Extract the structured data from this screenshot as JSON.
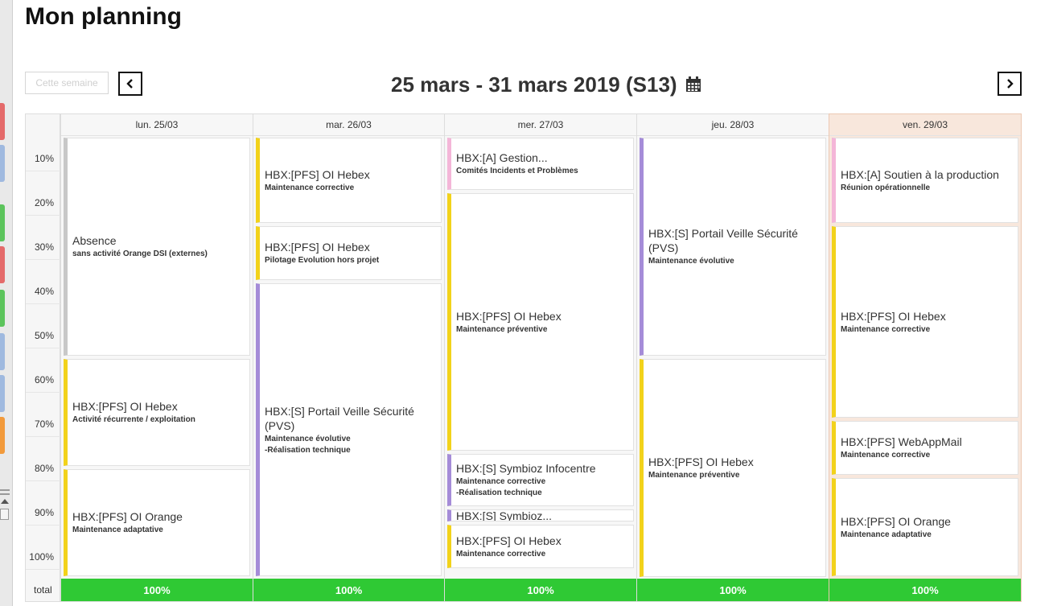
{
  "page_title": "Mon planning",
  "toolbar": {
    "this_week_label": "Cette semaine",
    "date_range": "25 mars - 31 mars 2019 (S13)"
  },
  "colors": {
    "total_bar": "#2fc934",
    "today_column": "#f8e7dc",
    "yellow": "#f2d21b",
    "purple": "#a58cd8",
    "grey": "#c8c8c8",
    "pink": "#f4b6d8"
  },
  "scale": {
    "labels": [
      "10%",
      "20%",
      "30%",
      "40%",
      "50%",
      "60%",
      "70%",
      "80%",
      "90%",
      "100%"
    ],
    "total_label": "total"
  },
  "days": [
    {
      "header": "lun. 25/03",
      "total": "100%",
      "today": false,
      "events": [
        {
          "title": "Absence",
          "subtitle": "sans activité Orange DSI (externes)",
          "color": "grey",
          "share": 0.5
        },
        {
          "title": "HBX:[PFS] OI Hebex",
          "subtitle": "Activité récurrente / exploitation",
          "color": "yellow",
          "share": 0.25
        },
        {
          "title": "HBX:[PFS] OI Orange",
          "subtitle": "Maintenance adaptative",
          "color": "yellow",
          "share": 0.25
        }
      ]
    },
    {
      "header": "mar. 26/03",
      "total": "100%",
      "today": false,
      "events": [
        {
          "title": "HBX:[PFS] OI Hebex",
          "subtitle": "Maintenance corrective",
          "color": "yellow",
          "share": 0.2
        },
        {
          "title": "HBX:[PFS] OI Hebex",
          "subtitle": "Pilotage Evolution hors projet",
          "color": "yellow",
          "share": 0.13
        },
        {
          "title": "HBX:[S] Portail Veille Sécurité (PVS)",
          "subtitle": "Maintenance évolutive",
          "subtitle2": "-Réalisation technique",
          "color": "purple",
          "share": 0.67
        }
      ]
    },
    {
      "header": "mer. 27/03",
      "total": "100%",
      "today": false,
      "events": [
        {
          "title": "HBX:[A] Gestion...",
          "subtitle": "Comités Incidents et Problèmes",
          "color": "pink",
          "share": 0.125
        },
        {
          "title": "HBX:[PFS] OI Hebex",
          "subtitle": "Maintenance préventive",
          "color": "yellow",
          "share": 0.59
        },
        {
          "title": "HBX:[S] Symbioz Infocentre",
          "subtitle": "Maintenance corrective",
          "subtitle2": "-Réalisation technique",
          "color": "purple",
          "share": 0.125
        },
        {
          "title": "HBX:[S] Symbioz...",
          "subtitle": "",
          "color": "purple",
          "share": 0.035
        },
        {
          "title": "HBX:[PFS] OI Hebex",
          "subtitle": "Maintenance corrective",
          "color": "yellow",
          "share": 0.105
        }
      ]
    },
    {
      "header": "jeu. 28/03",
      "total": "100%",
      "today": false,
      "events": [
        {
          "title": "HBX:[S] Portail Veille Sécurité (PVS)",
          "subtitle": "Maintenance évolutive",
          "color": "purple",
          "share": 0.5
        },
        {
          "title": "HBX:[PFS] OI Hebex",
          "subtitle": "Maintenance préventive",
          "color": "yellow",
          "share": 0.5
        }
      ]
    },
    {
      "header": "ven. 29/03",
      "total": "100%",
      "today": true,
      "events": [
        {
          "title": "HBX:[A] Soutien à la production",
          "subtitle": "Réunion opérationnelle",
          "color": "pink",
          "share": 0.2
        },
        {
          "title": "HBX:[PFS] OI Hebex",
          "subtitle": "Maintenance corrective",
          "color": "yellow",
          "share": 0.44
        },
        {
          "title": "HBX:[PFS] WebAppMail",
          "subtitle": "Maintenance corrective",
          "color": "yellow",
          "share": 0.13
        },
        {
          "title": "HBX:[PFS] OI Orange",
          "subtitle": "Maintenance adaptative",
          "color": "yellow",
          "share": 0.23
        }
      ]
    }
  ]
}
